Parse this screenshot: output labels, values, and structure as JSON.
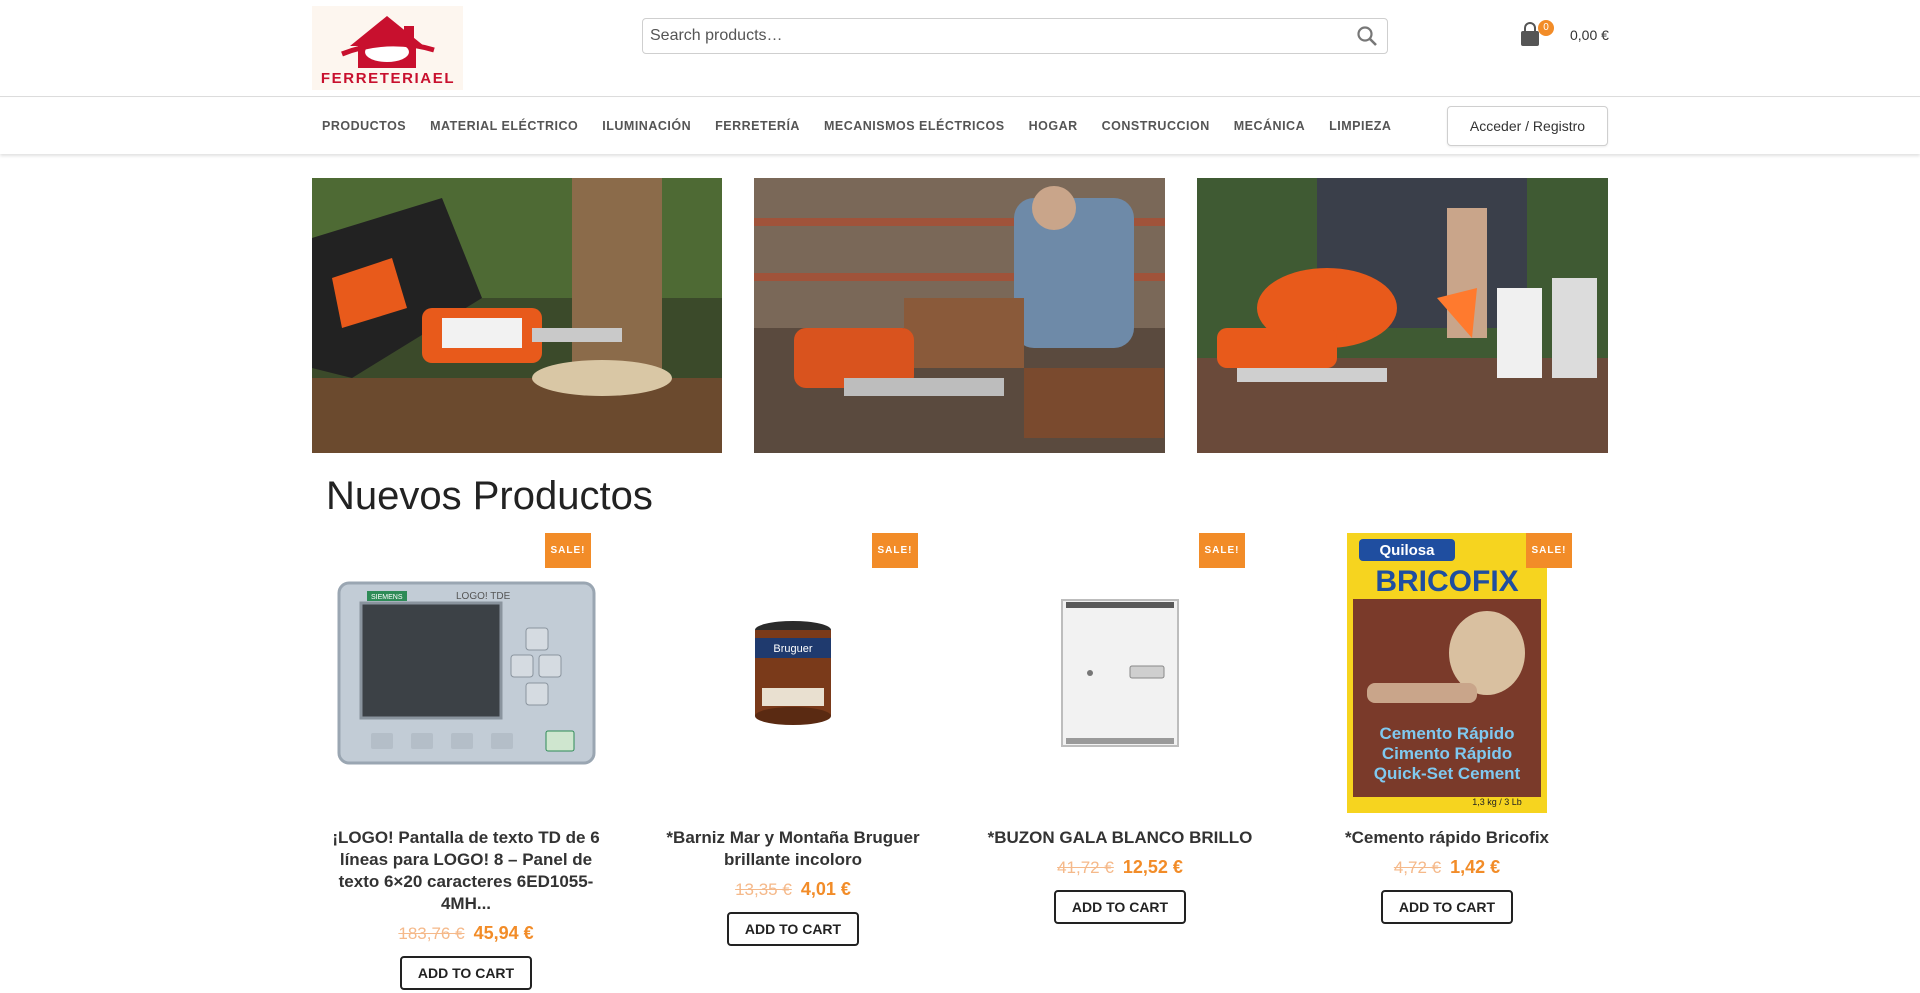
{
  "header": {
    "logo_text": "FERRETERIAEL",
    "search_placeholder": "Search products…",
    "cart_count": "0",
    "cart_total": "0,00 €"
  },
  "nav": {
    "items": [
      "PRODUCTOS",
      "MATERIAL ELÉCTRICO",
      "ILUMINACIÓN",
      "FERRETERÍA",
      "MECANISMOS ELÉCTRICOS",
      "HOGAR",
      "CONSTRUCCION",
      "MECÁNICA",
      "LIMPIEZA"
    ],
    "login_label": "Acceder / Registro"
  },
  "section_title": "Nuevos Productos",
  "products": [
    {
      "name": "¡LOGO! Pantalla de texto TD de 6 líneas para LOGO! 8 – Panel de texto 6×20 caracteres 6ED1055-4MH...",
      "old_price": "183,76 €",
      "price": "45,94 €",
      "badge": "SALE!",
      "button": "ADD TO CART"
    },
    {
      "name": "*Barniz Mar y Montaña Bruguer brillante incoloro",
      "old_price": "13,35 €",
      "price": "4,01 €",
      "badge": "SALE!",
      "button": "ADD TO CART"
    },
    {
      "name": "*BUZON GALA BLANCO BRILLO",
      "old_price": "41,72 €",
      "price": "12,52 €",
      "badge": "SALE!",
      "button": "ADD TO CART"
    },
    {
      "name": "*Cemento rápido Bricofix",
      "old_price": "4,72 €",
      "price": "1,42 €",
      "badge": "SALE!",
      "button": "ADD TO CART"
    }
  ],
  "product_image_text": {
    "logo_panel_brand": "SIEMENS",
    "logo_panel_model": "LOGO! TDE",
    "barniz_brand": "Bruguer",
    "bricofix_brand": "Quilosa",
    "bricofix_name": "BRICOFIX",
    "bricofix_line1": "Cemento Rápido",
    "bricofix_line2": "Cimento Rápido",
    "bricofix_line3": "Quick-Set Cement",
    "bricofix_weight": "1,3 kg / 3 Lb"
  },
  "colors": {
    "accent": "#f28c28",
    "logo_red": "#c8102e"
  }
}
